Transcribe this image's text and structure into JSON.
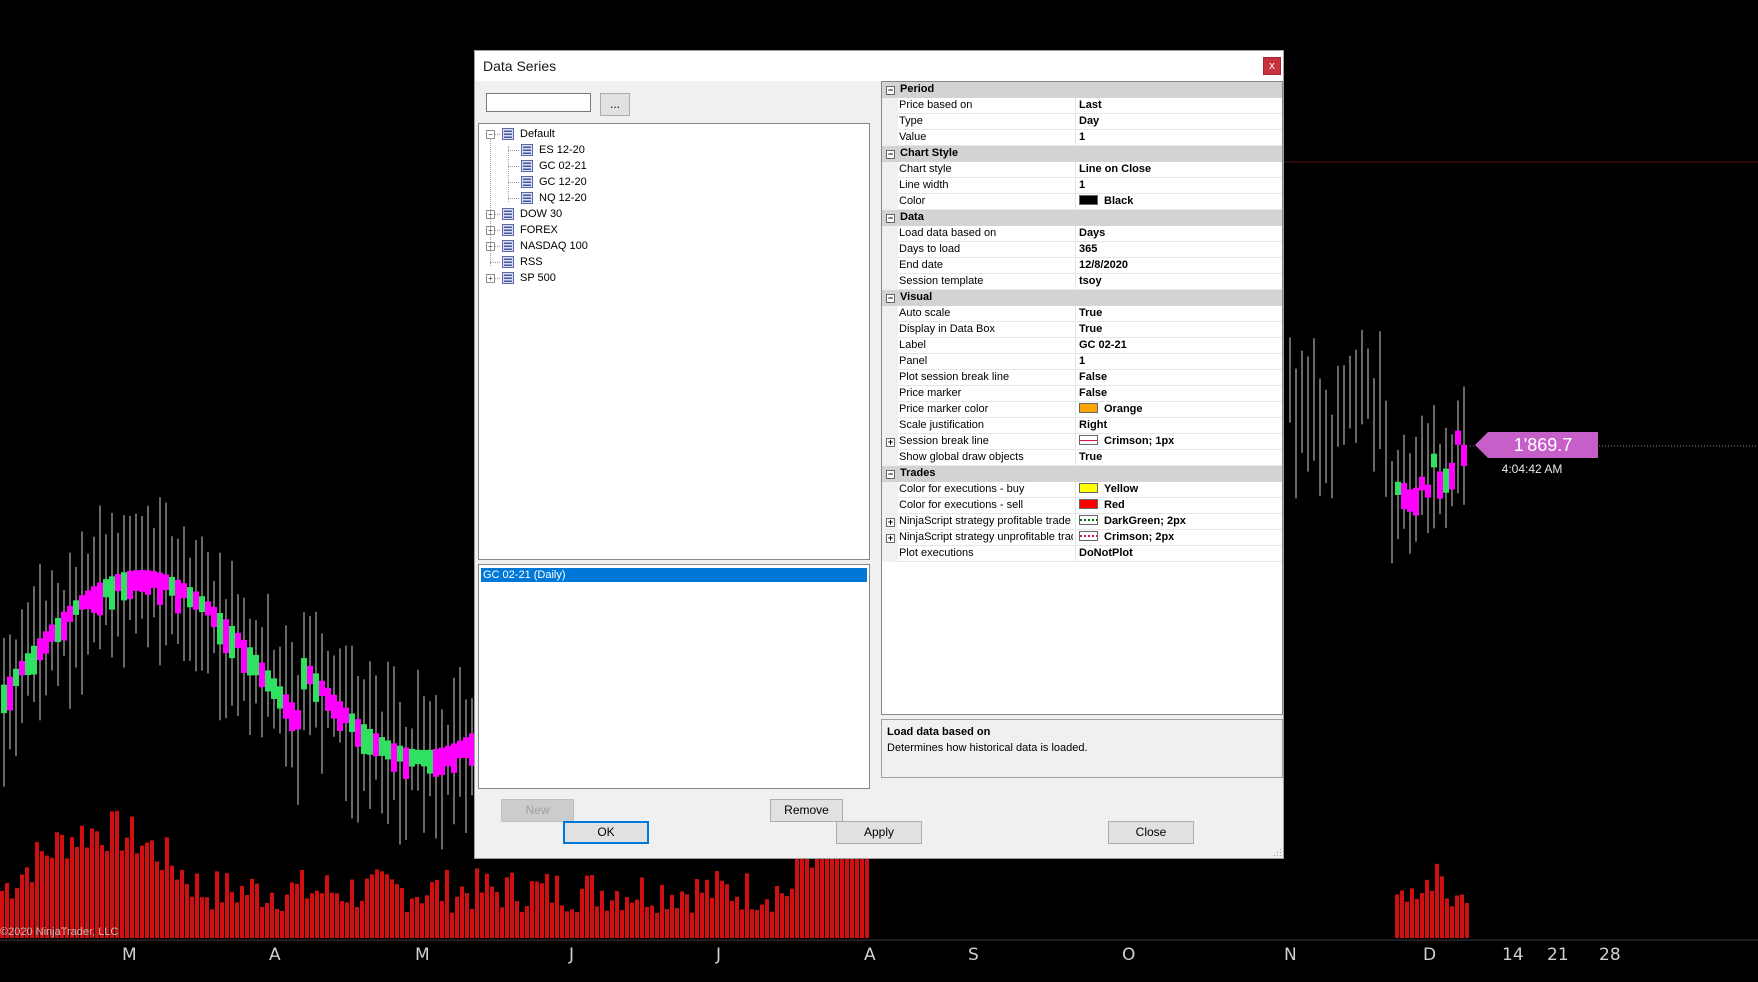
{
  "chart": {
    "copyright": "©2020 NinjaTrader, LLC",
    "price_tag": "1'869.7",
    "time_label": "4:04:42 AM",
    "x_axis_labels": [
      "M",
      "A",
      "M",
      "J",
      "J",
      "A",
      "S",
      "O",
      "N",
      "D",
      "14",
      "21",
      "28"
    ],
    "colors": {
      "volume": "#d01010",
      "bar_magenta": "#ff00ff",
      "bar_green": "#30e060",
      "price_tag": "#c75fc9"
    }
  },
  "dialog": {
    "title": "Data Series",
    "close_glyph": "x",
    "search_value": "",
    "browse_label": "...",
    "tree": [
      {
        "label": "Default",
        "expanded": true
      },
      {
        "label": "ES 12-20",
        "child": true
      },
      {
        "label": "GC 02-21",
        "child": true
      },
      {
        "label": "GC 12-20",
        "child": true
      },
      {
        "label": "NQ 12-20",
        "child": true
      },
      {
        "label": "DOW 30",
        "expandable": true
      },
      {
        "label": "FOREX",
        "expandable": true
      },
      {
        "label": "NASDAQ 100",
        "expandable": true
      },
      {
        "label": "RSS",
        "expandable": false
      },
      {
        "label": "SP 500",
        "expandable": true
      }
    ],
    "series_selected": "GC 02-21 (Daily)",
    "new_label": "New",
    "remove_label": "Remove",
    "ok_label": "OK",
    "apply_label": "Apply",
    "close_label": "Close",
    "properties": [
      {
        "cat": "Period"
      },
      {
        "name": "Price based on",
        "value": "Last"
      },
      {
        "name": "Type",
        "value": "Day"
      },
      {
        "name": "Value",
        "value": "1"
      },
      {
        "cat": "Chart Style"
      },
      {
        "name": "Chart style",
        "value": "Line on Close"
      },
      {
        "name": "Line width",
        "value": "1"
      },
      {
        "name": "Color",
        "value": "Black",
        "swatch": "#000000"
      },
      {
        "cat": "Data"
      },
      {
        "name": "Load data based on",
        "value": "Days"
      },
      {
        "name": "Days to load",
        "value": "365"
      },
      {
        "name": "End date",
        "value": "12/8/2020"
      },
      {
        "name": "Session template",
        "value": "tsoy"
      },
      {
        "cat": "Visual"
      },
      {
        "name": "Auto scale",
        "value": "True"
      },
      {
        "name": "Display in Data Box",
        "value": "True"
      },
      {
        "name": "Label",
        "value": "GC 02-21"
      },
      {
        "name": "Panel",
        "value": "1"
      },
      {
        "name": "Plot session break line",
        "value": "False"
      },
      {
        "name": "Price marker",
        "value": "False"
      },
      {
        "name": "Price marker color",
        "value": "Orange",
        "swatch": "#ffa500"
      },
      {
        "name": "Scale justification",
        "value": "Right"
      },
      {
        "name": "Session break line",
        "value": "Crimson; 1px",
        "swatch": "line-crimson",
        "expandable": true
      },
      {
        "name": "Show global draw objects",
        "value": "True"
      },
      {
        "cat": "Trades"
      },
      {
        "name": "Color for executions - buy",
        "value": "Yellow",
        "swatch": "#ffff00"
      },
      {
        "name": "Color for executions - sell",
        "value": "Red",
        "swatch": "#ff0000"
      },
      {
        "name": "NinjaScript strategy profitable trade",
        "value": "DarkGreen; 2px",
        "swatch": "dotted-darkgreen",
        "expandable": true
      },
      {
        "name": "NinjaScript strategy unprofitable trade",
        "value": "Crimson; 2px",
        "swatch": "dotted-crimson",
        "expandable": true
      },
      {
        "name": "Plot executions",
        "value": "DoNotPlot"
      }
    ],
    "description": {
      "title": "Load data based on",
      "text": "Determines how historical data is loaded."
    }
  }
}
